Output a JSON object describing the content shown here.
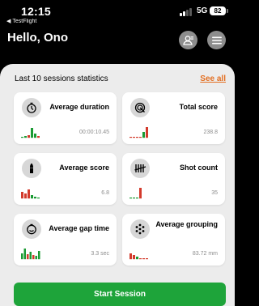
{
  "status_bar": {
    "time": "12:15",
    "back_app": "TestFlight",
    "network": "5G",
    "battery": "82"
  },
  "header": {
    "greeting": "Hello, Ono"
  },
  "stats": {
    "title": "Last 10 sessions statistics",
    "see_all": "See all",
    "cards": [
      {
        "label": "Average duration",
        "value": "00:00:10.45",
        "icon": "stopwatch-icon"
      },
      {
        "label": "Total score",
        "value": "238.8",
        "icon": "target-score-icon"
      },
      {
        "label": "Average score",
        "value": "6.8",
        "icon": "bullet-icon"
      },
      {
        "label": "Shot count",
        "value": "35",
        "icon": "tally-icon"
      },
      {
        "label": "Average gap time",
        "value": "3.3 sec",
        "icon": "timer-icon"
      },
      {
        "label": "Average grouping",
        "value": "83.72 mm",
        "icon": "grouping-dots-icon"
      }
    ]
  },
  "actions": {
    "start_session": "Start Session"
  },
  "colors": {
    "accent_orange": "#e36f22",
    "start_green": "#1ea43a",
    "spark_green": "#1b9b34",
    "spark_red": "#d33a2c"
  }
}
